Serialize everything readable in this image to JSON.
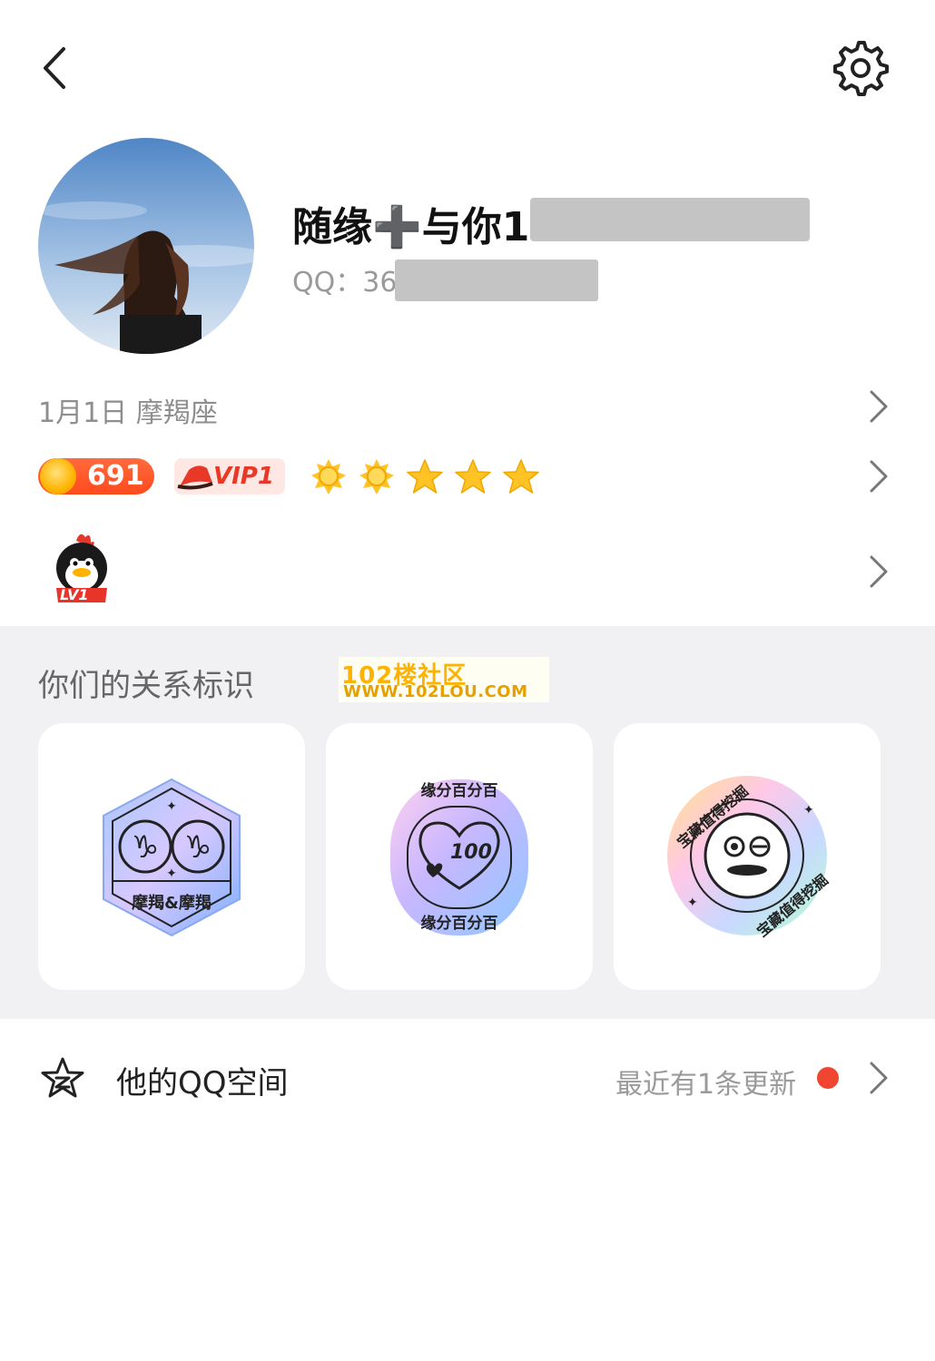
{
  "header": {
    "back_icon": "chevron-left-icon",
    "settings_icon": "gear-icon"
  },
  "profile": {
    "avatar_icon": "avatar",
    "name": "随缘➕与你1",
    "qq_label": "QQ：36"
  },
  "info_rows": {
    "birthday": "1月1日  摩羯座",
    "coin_value": "691",
    "vip_label": "VIP1",
    "level_badge": "LV1"
  },
  "relationship": {
    "title": "你们的关系标识",
    "watermark_line1": "102楼社区",
    "watermark_line2": "WWW.102LOU.COM",
    "cards": [
      {
        "label": "摩羯&摩羯"
      },
      {
        "label_top": "缘分百分百",
        "number": "100",
        "label_bottom": "缘分百分百"
      },
      {
        "label_top": "宝藏值得挖掘",
        "label_bottom": "宝藏值得挖掘"
      }
    ]
  },
  "qzone": {
    "label": "他的QQ空间",
    "status": "最近有1条更新"
  },
  "colors": {
    "accent_red": "#f04530",
    "section_bg": "#f1f1f3",
    "coin_orange": "#ff5a2a",
    "vip_red": "#e73828"
  }
}
